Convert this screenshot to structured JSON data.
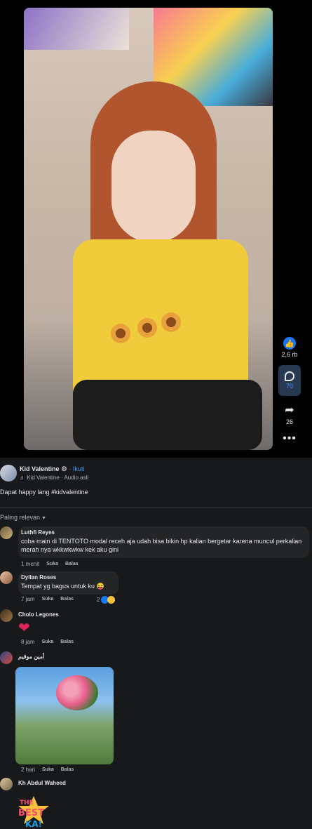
{
  "video": {
    "like_count": "2,6 rb",
    "comment_count": "70",
    "share_count": "26"
  },
  "author": {
    "name": "Kid Valentine",
    "follow": "· Ikuti",
    "audio": "Kid Valentine · Audio asli",
    "caption": "Dapat happy lang #kidvalentine"
  },
  "sort_label": "Paling relevan",
  "comments": [
    {
      "name": "Luthfi Reyes",
      "text": "coba main di TENTOTO modal receh aja udah bisa bikin hp kalian bergetar karena muncul perkalian merah nya wkkwkwkw kek aku gini",
      "time": "1 menit",
      "like": "Suka",
      "reply": "Balas"
    },
    {
      "name": "Dyllan Roses",
      "text": "Tempat yg bagus untuk ku 😝",
      "time": "7 jam",
      "like": "Suka",
      "reply": "Balas",
      "reactions": "2"
    },
    {
      "name": "Cholo Legones",
      "time": "8 jam",
      "like": "Suka",
      "reply": "Balas"
    },
    {
      "name": "أمين موقيم",
      "time": "2 hari",
      "like": "Suka",
      "reply": "Balas"
    },
    {
      "name": "Kh Abdul Waheed",
      "sticker_text": "THE BEST KA!"
    }
  ],
  "colors": {
    "accent": "#4599ff",
    "like_blue": "#1877f2",
    "panel_bg": "#18191a",
    "bubble_bg": "#242526"
  }
}
